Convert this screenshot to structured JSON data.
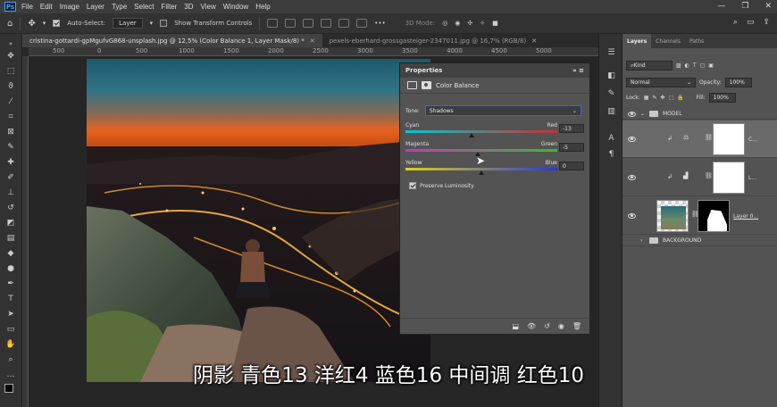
{
  "menu": [
    "File",
    "Edit",
    "Image",
    "Layer",
    "Type",
    "Select",
    "Filter",
    "3D",
    "View",
    "Window",
    "Help"
  ],
  "app_logo": "Ps",
  "options_bar": {
    "auto_select_label": "Auto-Select:",
    "auto_select_checked": true,
    "auto_select_value": "Layer",
    "show_transform_label": "Show Transform Controls",
    "mode_3d_label": "3D Mode:"
  },
  "tabs": [
    {
      "label": "cristina-gottardi-gpMgufvG868-unsplash.jpg @ 12,5% (Color Balance 1, Layer Mask/8) *",
      "active": true
    },
    {
      "label": "pexels-eberhard-grossgasteiger-2347011.jpg @ 16,7% (RGB/8)",
      "active": false
    }
  ],
  "ruler_labels": [
    "500",
    "0",
    "500",
    "1000",
    "1500",
    "2000",
    "2500",
    "3000",
    "3500",
    "4000",
    "4500",
    "5000"
  ],
  "properties": {
    "title": "Properties",
    "subtitle": "Color Balance",
    "tone_label": "Tone:",
    "tone_value": "Shadows",
    "sliders": [
      {
        "left": "Cyan",
        "right": "Red",
        "value": "-13",
        "level": -13
      },
      {
        "left": "Magenta",
        "right": "Green",
        "value": "-5",
        "level": -5
      },
      {
        "left": "Yellow",
        "right": "Blue",
        "value": "0",
        "level": 0
      }
    ],
    "preserve_luminosity_label": "Preserve Luminosity",
    "preserve_luminosity_checked": true
  },
  "layers_panel": {
    "tabs": [
      "Layers",
      "Channels",
      "Paths"
    ],
    "filter_value": "Kind",
    "blend_mode": "Normal",
    "opacity_label": "Opacity:",
    "opacity_value": "100%",
    "lock_label": "Lock:",
    "fill_label": "Fill:",
    "fill_value": "100%",
    "layers": [
      {
        "name": "MODEL",
        "kind": "group"
      },
      {
        "name": "C...",
        "kind": "color-balance"
      },
      {
        "name": "L...",
        "kind": "levels"
      },
      {
        "name": "Layer 0...",
        "kind": "pixel"
      },
      {
        "name": "BACKGROUND",
        "kind": "group"
      }
    ]
  },
  "subtitle_text": "阴影 青色13 洋红4 蓝色16 中间调 红色10",
  "colors": {
    "accent": "#2e6fd4",
    "panel": "#535353",
    "menubar": "#3c3c3c"
  }
}
